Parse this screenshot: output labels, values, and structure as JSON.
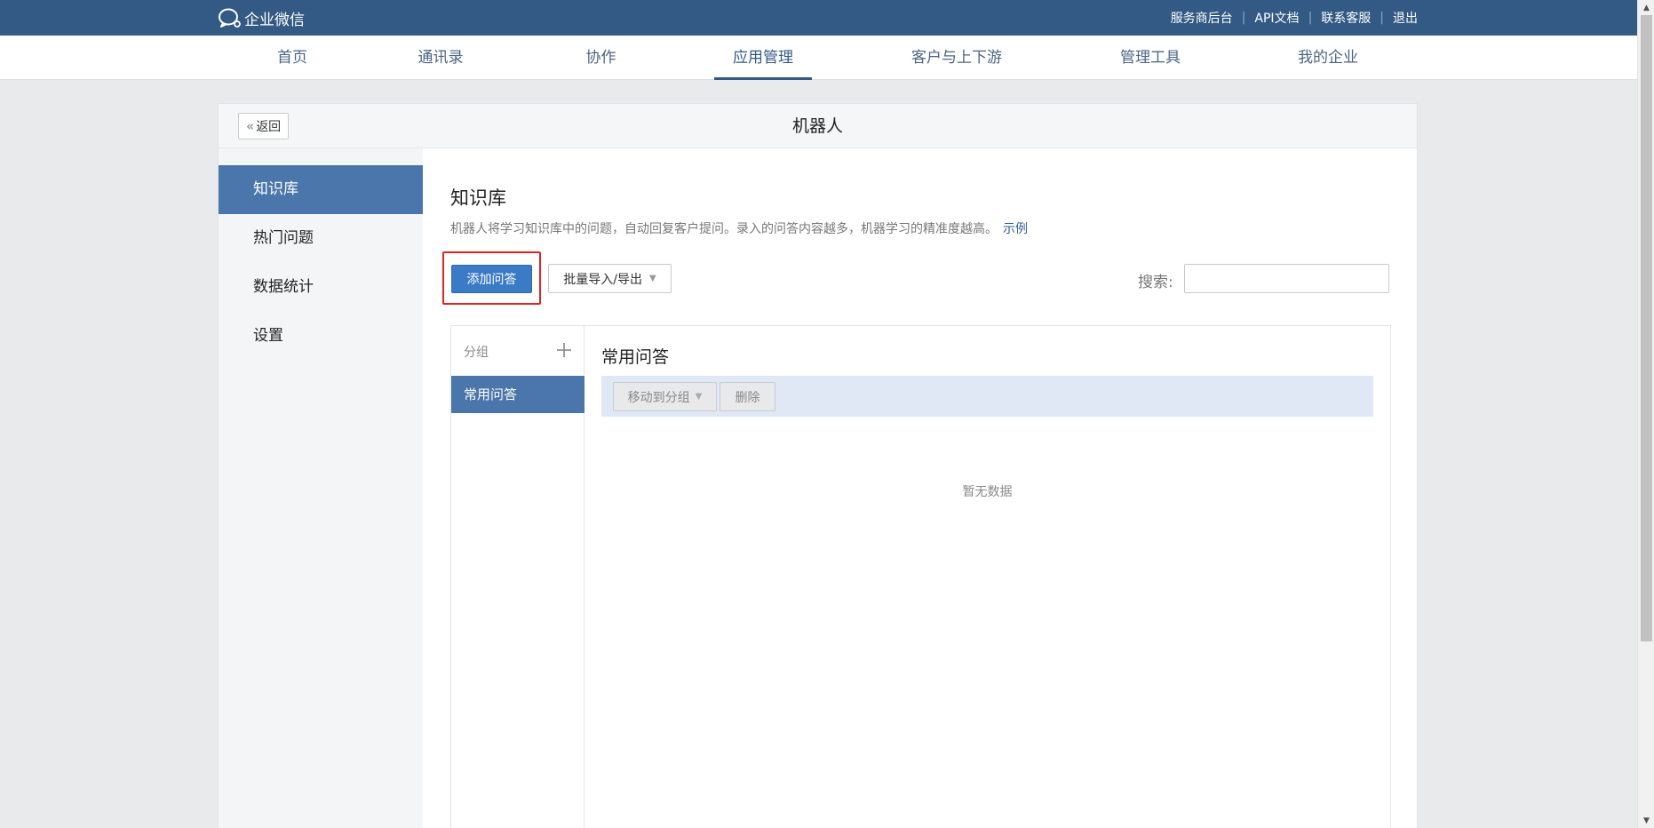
{
  "topbar": {
    "logo_text": "企业微信",
    "links": [
      "服务商后台",
      "API文档",
      "联系客服",
      "退出"
    ]
  },
  "nav": {
    "items": [
      "首页",
      "通讯录",
      "协作",
      "应用管理",
      "客户与上下游",
      "管理工具",
      "我的企业"
    ],
    "active": "应用管理"
  },
  "card": {
    "back_label": "返回",
    "title": "机器人"
  },
  "side_menu": {
    "items": [
      "知识库",
      "热门问题",
      "数据统计",
      "设置"
    ],
    "active": "知识库"
  },
  "main": {
    "title": "知识库",
    "description": "机器人将学习知识库中的问题，自动回复客户提问。录入的问答内容越多，机器学习的精准度越高。",
    "example_link": "示例",
    "add_button": "添加问答",
    "batch_button": "批量导入/导出",
    "search_label": "搜索:",
    "search_value": ""
  },
  "groups": {
    "header": "分组",
    "items": [
      "常用问答"
    ],
    "selected": "常用问答"
  },
  "qa_list": {
    "title": "常用问答",
    "move_button": "移动到分组",
    "delete_button": "删除",
    "empty_text": "暂无数据"
  },
  "colors": {
    "topbar": "#335a84",
    "active_menu": "#4a76ab",
    "primary_button": "#3b7bc6",
    "highlight_box": "#e02424",
    "toolbar_bg": "#dfe8f4"
  },
  "icons": {
    "logo": "wework-chat-icon",
    "back": "double-chevron-left-icon",
    "add_group": "plus-icon",
    "dropdown": "caret-down-icon"
  }
}
